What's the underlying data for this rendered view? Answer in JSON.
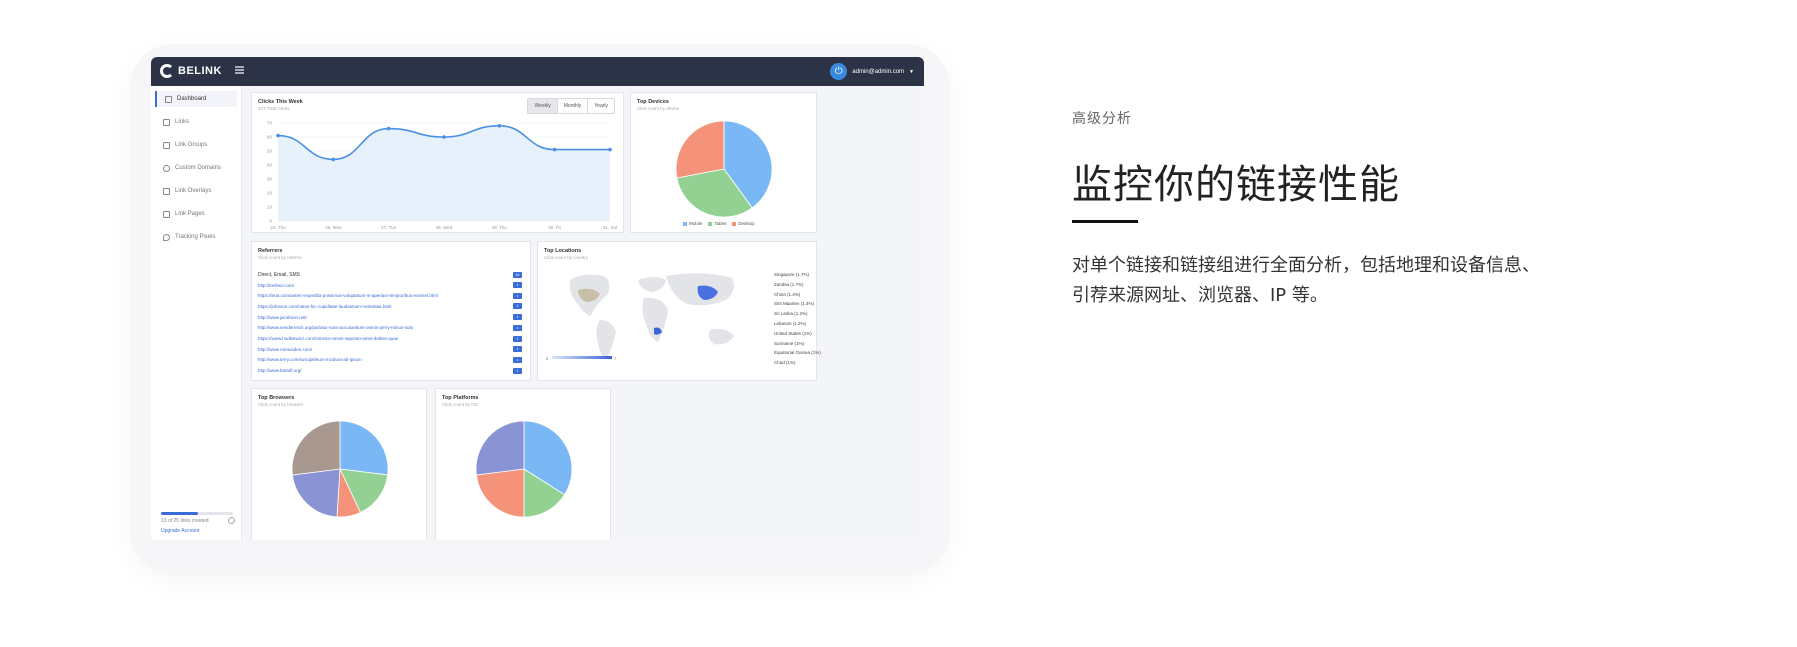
{
  "app": {
    "logo_text": "BELINK",
    "user_email": "admin@admin.com"
  },
  "sidebar": {
    "items": [
      {
        "label": "Dashboard",
        "icon": "home-icon"
      },
      {
        "label": "Links",
        "icon": "link-icon"
      },
      {
        "label": "Link Groups",
        "icon": "folder-icon"
      },
      {
        "label": "Custom Domains",
        "icon": "globe-icon"
      },
      {
        "label": "Link Overlays",
        "icon": "layers-icon"
      },
      {
        "label": "Link Pages",
        "icon": "page-icon"
      },
      {
        "label": "Tracking Pixels",
        "icon": "pin-icon"
      }
    ],
    "usage_text": "13 of 25 links created",
    "usage_fraction": 0.52,
    "upgrade_label": "Upgrade Account"
  },
  "clicks": {
    "title": "Clicks This Week",
    "subtitle": "473 Total Clicks",
    "tabs": [
      "Weekly",
      "Monthly",
      "Yearly"
    ],
    "active_tab": "Weekly"
  },
  "devices": {
    "title": "Top Devices",
    "subtitle": "Click count by device",
    "legend": [
      "Mobile",
      "Tablet",
      "Desktop"
    ]
  },
  "referrers": {
    "title": "Referrers",
    "subtitle": "Click count by referrer",
    "header_label": "Direct, Email, SMS",
    "header_count": "46",
    "rows": [
      "http://treihan.com/",
      "https://erat.com/autem-expedita-possimus-voluptatum-in-aperiam-tempor/bus-eveniet.html",
      "https://johnson.com/natus-hic-cupiditate-laudantium-molestiae.html",
      "http://www.jacobson.net/",
      "http://www.senderreich.org/pariatur-sunt-accusantium-omnis-perry-minus-sola",
      "https://www.hodkiewicz.com/minima-omnis-saponto-amet-debitis-quae",
      "http://www.ronnusden.com/",
      "http://www.terry.com/suscipit/eum-incidunt-ab-ipsum",
      "http://www.bartolf.org/"
    ],
    "row_count": "1"
  },
  "locations": {
    "title": "Top Locations",
    "subtitle": "Click count by country",
    "countries": [
      "Singapore (1.7%)",
      "Zambia (1.7%)",
      "China (1.4%)",
      "Sint Maarten (1.4%)",
      "Sri Lanka (1.2%)",
      "Lebanon (1.2%)",
      "United States (1%)",
      "Suriname (1%)",
      "Equatorial Guinea (1%)",
      "Chad (1%)"
    ],
    "scale_min": "0",
    "scale_max": "7"
  },
  "browsers": {
    "title": "Top Browsers",
    "subtitle": "Click count by browser"
  },
  "platforms": {
    "title": "Top Platforms",
    "subtitle": "Click count by OS"
  },
  "promo": {
    "eyebrow": "高级分析",
    "headline": "监控你的链接性能",
    "description": "对单个链接和链接组进行全面分析，包括地理和设备信息、引荐来源网址、浏览器、IP 等。"
  },
  "chart_data": [
    {
      "type": "area",
      "title": "Clicks This Week",
      "categories": [
        "22, Thu",
        "25, Mon",
        "27, Tue",
        "28, Wed",
        "29, Thu",
        "30, Fri",
        "31, Sat"
      ],
      "values": [
        61,
        44,
        66,
        60,
        68,
        51,
        51
      ],
      "ylim": [
        0,
        70
      ],
      "yticks": [
        0,
        10,
        20,
        30,
        40,
        50,
        60,
        70
      ],
      "grid": true,
      "color": "#4a90e2"
    },
    {
      "type": "pie",
      "title": "Top Devices",
      "labels": [
        "Mobile",
        "Tablet",
        "Desktop"
      ],
      "values": [
        40,
        32,
        28
      ],
      "colors": [
        "#79b8f4",
        "#93d192",
        "#f4937a"
      ]
    },
    {
      "type": "pie",
      "title": "Top Browsers",
      "values": [
        27,
        16,
        8,
        22,
        27
      ],
      "colors": [
        "#79b8f4",
        "#93d192",
        "#f4937a",
        "#8a94d4",
        "#a89890"
      ]
    },
    {
      "type": "pie",
      "title": "Top Platforms",
      "values": [
        34,
        16,
        23,
        27
      ],
      "colors": [
        "#79b8f4",
        "#93d192",
        "#f4937a",
        "#8a94d4"
      ]
    }
  ]
}
